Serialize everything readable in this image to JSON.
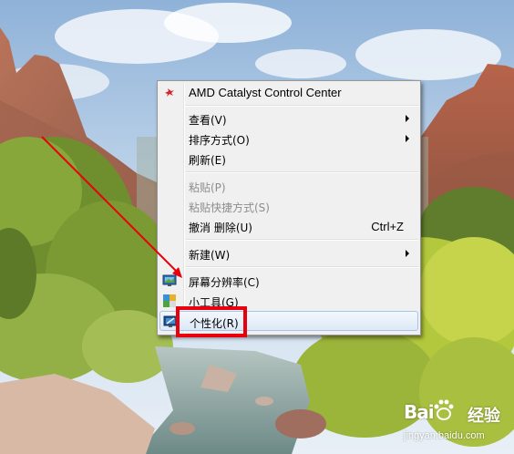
{
  "context_menu": {
    "items": [
      {
        "label": "AMD Catalyst Control Center",
        "icon": "amd-catalyst-icon"
      },
      {
        "label": "查看(V)",
        "submenu": true
      },
      {
        "label": "排序方式(O)",
        "submenu": true
      },
      {
        "label": "刷新(E)"
      },
      {
        "label": "粘贴(P)",
        "disabled": true
      },
      {
        "label": "粘贴快捷方式(S)",
        "disabled": true
      },
      {
        "label": "撤消 删除(U)",
        "shortcut": "Ctrl+Z"
      },
      {
        "label": "新建(W)",
        "submenu": true
      },
      {
        "label": "屏幕分辨率(C)",
        "icon": "screen-resolution-icon"
      },
      {
        "label": "小工具(G)",
        "icon": "gadgets-icon"
      },
      {
        "label": "个性化(R)",
        "icon": "personalize-icon",
        "highlighted": true
      }
    ]
  },
  "annotation": {
    "color": "#e8000c"
  },
  "watermark": {
    "brand_left": "Bai",
    "brand_right": "经验",
    "url": "jingyan.baidu.com"
  }
}
